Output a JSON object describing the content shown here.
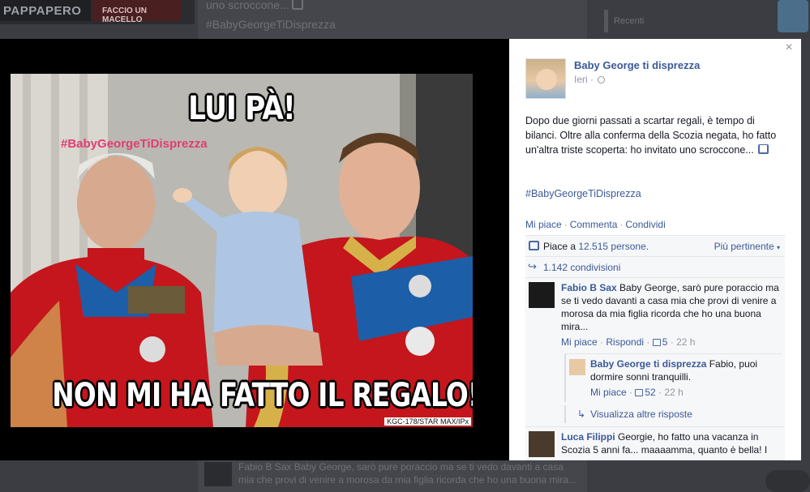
{
  "background": {
    "thumb1_label": "PAPPAPERO",
    "thumb2_label": "FACCIO UN MACELLO",
    "post_lines": [
      "uno scroccone...",
      "#BabyGeorgeTiDisprezza"
    ],
    "sidebar_label": "Recenti",
    "bottom_post_name": "Fabio B Sax",
    "bottom_post_text": " Baby George, sarò pure poraccio ma se ti vedo davanti a casa mia che provi di venire a morosa da mia figlia ricorda che ho una buona mira..."
  },
  "photo": {
    "top_caption": "LUI PÀ!",
    "hashtag_overlay": "#BabyGeorgeTiDisprezza",
    "bottom_caption": "NON MI HA FATTO IL REGALO!",
    "credit": "KGC-178/STAR MAX/IPx"
  },
  "post": {
    "page_name": "Baby George ti disprezza",
    "time": "Ieri",
    "text": "Dopo due giorni passati a scartar regali, è tempo di bilanci. Oltre alla conferma della Scozia negata, ho fatto un'altra triste scoperta: ho invitato uno scroccone...",
    "hashtag": "#BabyGeorgeTiDisprezza",
    "actions": [
      "Mi piace",
      "Commenta",
      "Condividi"
    ],
    "likes_prefix": "Piace a ",
    "likes_link": "12.515 persone.",
    "sort_label": "Più pertinente",
    "shares": "1.142 condivisioni"
  },
  "comments": [
    {
      "name": "Fabio B Sax",
      "text": " Baby George, sarò pure poraccio ma se ti vedo davanti a casa mia che provi di venire a morosa da mia figlia ricorda che ho una buona mira...",
      "like_label": "Mi piace",
      "reply_label": "Rispondi",
      "likes": "5",
      "time": "22 h",
      "reply": {
        "name": "Baby George ti disprezza",
        "text": " Fabio, puoi dormire sonni tranquilli.",
        "like_label": "Mi piace",
        "likes": "52",
        "time": "22 h"
      },
      "more_replies": "Visualizza altre risposte"
    },
    {
      "name": "Luca Filippi",
      "text": " Georgie, ho fatto una vacanza in Scozia 5 anni fa... maaaamma, quanto è bella! I"
    }
  ],
  "colors": {
    "link": "#3b5998",
    "meta": "#9197a3",
    "hashtag_overlay": "#e13d73"
  }
}
